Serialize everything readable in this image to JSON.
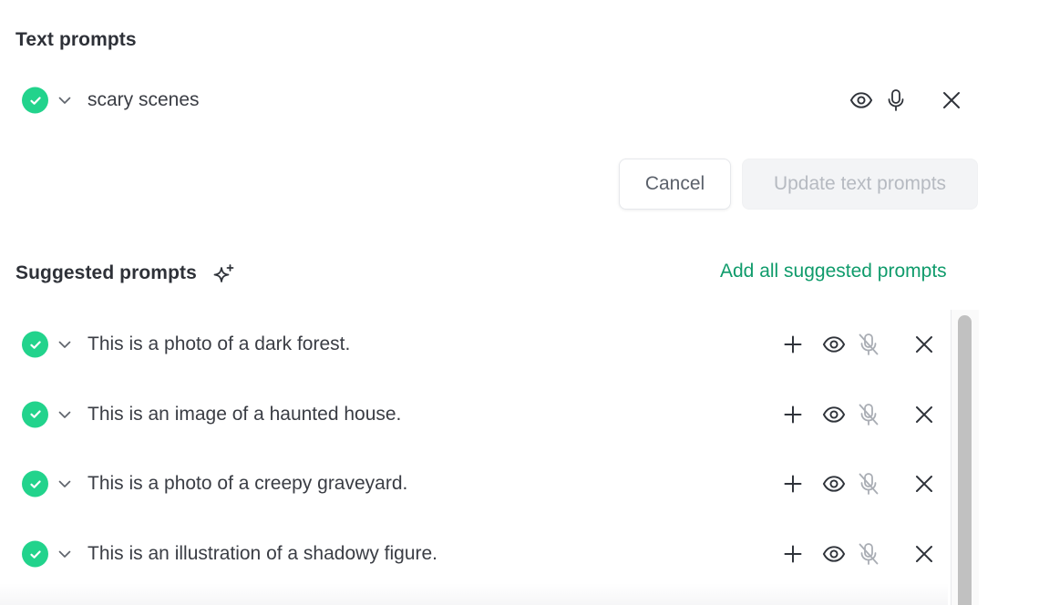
{
  "text_prompts": {
    "title": "Text prompts",
    "items": [
      {
        "label": "scary scenes"
      }
    ],
    "cancel_label": "Cancel",
    "update_label": "Update text prompts"
  },
  "suggested_prompts": {
    "title": "Suggested prompts",
    "add_all_label": "Add all suggested prompts",
    "items": [
      {
        "label": "This is a photo of a dark forest."
      },
      {
        "label": "This is an image of a haunted house."
      },
      {
        "label": "This is a photo of a creepy graveyard."
      },
      {
        "label": "This is an illustration of a shadowy figure."
      }
    ]
  },
  "icons": {
    "check": "check-circle-icon",
    "chevron": "chevron-down-icon",
    "eye": "eye-icon",
    "mic": "microphone-icon",
    "mic_off": "microphone-off-icon",
    "close": "close-icon",
    "add": "plus-icon",
    "sparkle": "sparkles-icon"
  },
  "colors": {
    "accent": "#0f9b6b",
    "check": "#22d38c",
    "text": "#3a3d44"
  }
}
